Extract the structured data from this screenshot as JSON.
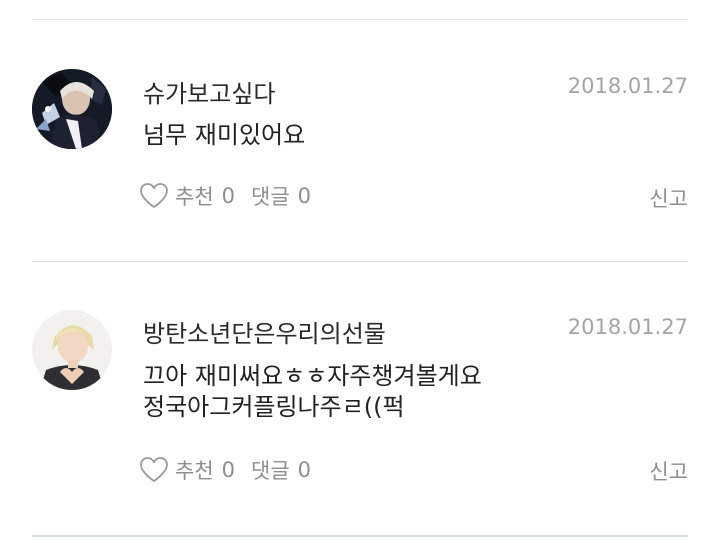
{
  "comments": [
    {
      "author": "슈가보고싶다",
      "date": "2018.01.27",
      "lines": [
        "넘무 재미있어요"
      ],
      "like_label": "추천",
      "like_count": "0",
      "reply_label": "댓글",
      "reply_count": "0",
      "report_label": "신고",
      "avatar_icon": "user-avatar-photo"
    },
    {
      "author": "방탄소년단은우리의선물",
      "date": "2018.01.27",
      "lines": [
        "끄아 재미써요ㅎㅎ자주챙겨볼게요",
        "정국아그커플링나주ㄹ((퍽"
      ],
      "like_label": "추천",
      "like_count": "0",
      "reply_label": "댓글",
      "reply_count": "0",
      "report_label": "신고",
      "avatar_icon": "user-avatar-photo"
    }
  ],
  "colors": {
    "author": "#2a2a2a",
    "date": "#a4a4a4",
    "body": "#222222",
    "action": "#8e8e8e",
    "divider": "#e3e3e3"
  }
}
